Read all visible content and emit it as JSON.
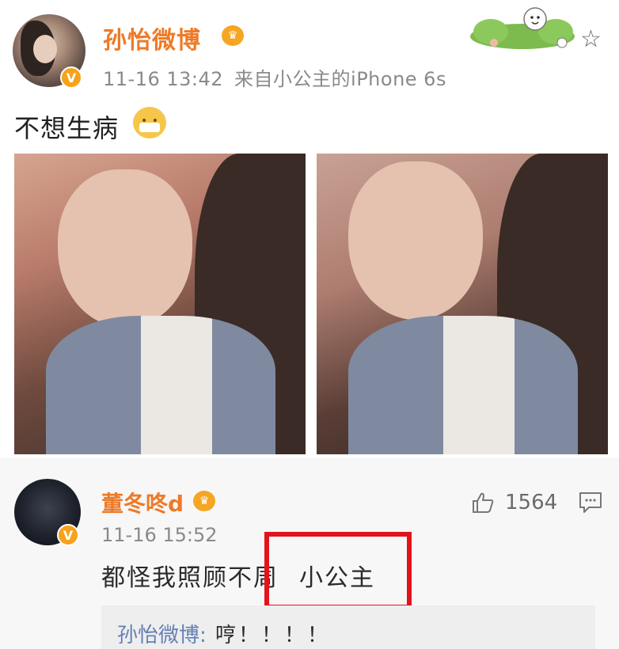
{
  "post": {
    "author": "孙怡微博",
    "timestamp": "11-16 13:42",
    "source": "来自小公主的iPhone 6s",
    "text": "不想生病",
    "verified_icon": "verified-v-icon",
    "vip_icon": "crown-icon",
    "emoji": "mask-emoji-icon",
    "favorite_icon": "star-outline-icon"
  },
  "comment": {
    "author": "董冬咚d",
    "timestamp": "11-16 15:52",
    "text_main": "都怪我照顾不周",
    "text_highlight": "小公主",
    "like_count": "1564",
    "like_icon": "thumbs-up-icon",
    "reply_icon": "comment-icon",
    "highlight_color": "#e3131b"
  },
  "reply": {
    "author": "孙怡微博:",
    "text": "哼！！！！"
  },
  "colors": {
    "author_name": "#ee7a28",
    "reply_author": "#6480b4",
    "meta": "#8a8a8a"
  }
}
